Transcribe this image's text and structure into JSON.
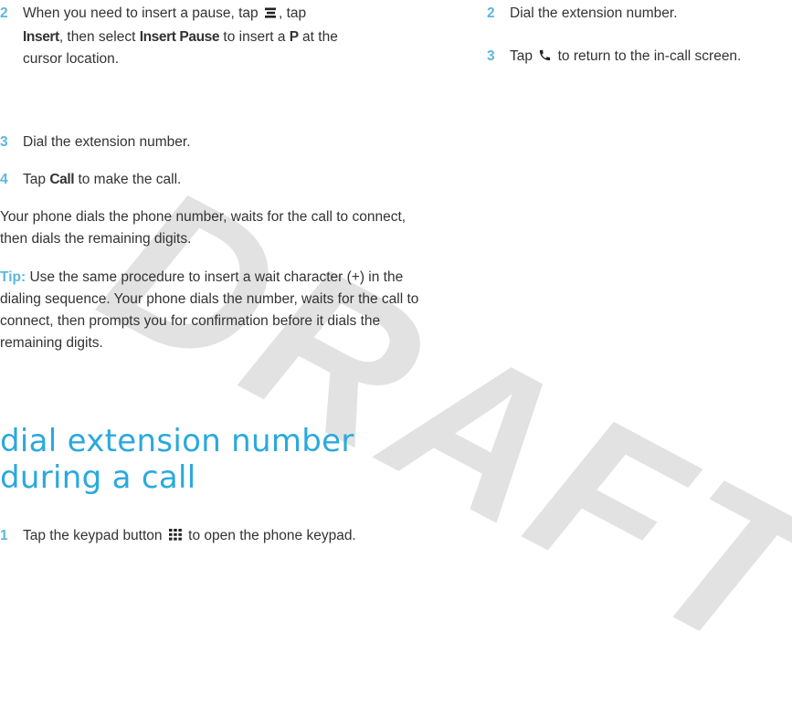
{
  "watermark": "DRAFT",
  "left": {
    "step2": {
      "number": "2",
      "line1a": "When you need to insert a pause, tap",
      "menu_icon": "menu-icon",
      "line1b": ", tap",
      "insert": "Insert",
      "line2a": ", then select",
      "insert_pause": "Insert Pause",
      "line2b": "to insert a",
      "p": "P",
      "line2c": "at the",
      "line3": "cursor location."
    },
    "step3": {
      "number": "3",
      "text": "Dial the extension number."
    },
    "step4": {
      "number": "4",
      "text_a": "Tap",
      "call": "Call",
      "text_b": "to make the call."
    },
    "para1": "Your phone dials the phone number, waits for the call to connect, then dials the remaining digits.",
    "tip": {
      "label": "Tip:",
      "text": "Use the same procedure to insert a wait character (+) in the dialing sequence. Your phone dials the number, waits for the call to connect, then prompts you for confirmation before it dials the remaining digits."
    },
    "heading_line1": "dial extension number",
    "heading_line2": "during a call",
    "step1b": {
      "number": "1",
      "text_a": "Tap the keypad button",
      "keypad_icon": "keypad-icon",
      "text_b": "to open the phone keypad."
    }
  },
  "right": {
    "step2": {
      "number": "2",
      "text": "Dial the extension number."
    },
    "step3": {
      "number": "3",
      "text_a": "Tap",
      "phone_icon": "phone-icon",
      "text_b": "to return to the in-call screen."
    }
  },
  "colors": {
    "accent": "#5bb7e0",
    "heading": "#2aa9dd",
    "body": "#333333",
    "watermark": "#e2e2e2"
  }
}
